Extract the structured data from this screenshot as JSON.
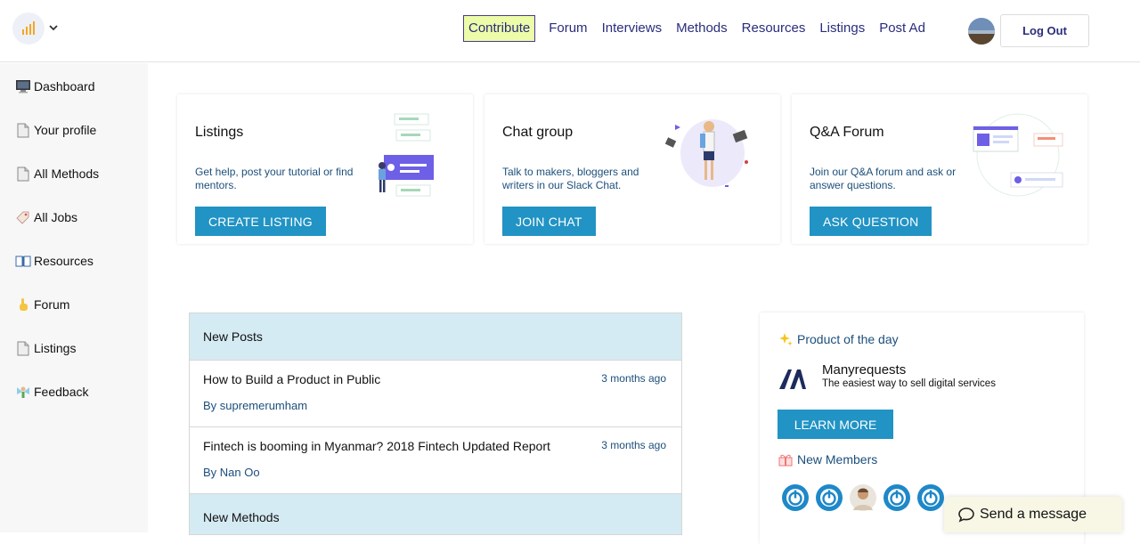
{
  "header": {
    "logo_icon": "bar-chart-logo-icon",
    "nav": [
      {
        "label": "Contribute",
        "highlight": true
      },
      {
        "label": "Forum"
      },
      {
        "label": "Interviews"
      },
      {
        "label": "Methods"
      },
      {
        "label": "Resources"
      },
      {
        "label": "Listings"
      },
      {
        "label": "Post Ad"
      }
    ],
    "logout_label": "Log Out"
  },
  "sidebar": {
    "items": [
      {
        "icon": "desktop-icon",
        "label": "Dashboard"
      },
      {
        "icon": "page-icon",
        "label": "Your profile"
      },
      {
        "icon": "page-icon",
        "label": "All Methods"
      },
      {
        "icon": "tag-icon",
        "label": "All Jobs"
      },
      {
        "icon": "book-icon",
        "label": "Resources"
      },
      {
        "icon": "pointing-hand-icon",
        "label": "Forum"
      },
      {
        "icon": "page-icon",
        "label": "Listings"
      },
      {
        "icon": "fairy-icon",
        "label": "Feedback"
      }
    ]
  },
  "cards": [
    {
      "title": "Listings",
      "text": "Get help, post your tutorial or find mentors.",
      "button": "CREATE LISTING"
    },
    {
      "title": "Chat group",
      "text": "Talk to makers, bloggers and writers in our Slack Chat.",
      "button": "JOIN CHAT"
    },
    {
      "title": "Q&A Forum",
      "text": "Join our Q&A forum and ask or answer questions.",
      "button": "ASK QUESTION"
    }
  ],
  "posts": {
    "header": "New Posts",
    "items": [
      {
        "title": "How to Build a Product in Public",
        "time": "3 months ago",
        "author": "By supremerumham"
      },
      {
        "title": "Fintech is booming in Myanmar? 2018 Fintech Updated Report",
        "time": "3 months ago",
        "author": "By Nan Oo"
      }
    ],
    "methods_header": "New Methods"
  },
  "product_of_day": {
    "title": "Product of the day",
    "icon": "sparkles-icon",
    "name": "Manyrequests",
    "tagline": "The easiest way to sell digital services",
    "button": "LEARN MORE",
    "members_title": "New Members",
    "members_icon": "ribbon-icon"
  },
  "chat_widget": {
    "label": "Send a message",
    "icon": "speech-bubble-icon"
  },
  "colors": {
    "accent": "#2193c4",
    "nav_text": "#2a2d7c",
    "panel_header": "#d5ebf3",
    "contribute_bg": "#ecfca8",
    "link_blue": "#1c4f7b"
  }
}
